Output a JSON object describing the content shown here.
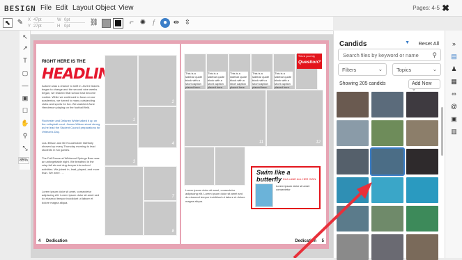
{
  "app": {
    "logo": "BESIGN",
    "menus": [
      "File",
      "Edit",
      "Layout",
      "Object",
      "View"
    ],
    "pages_label": "Pages: 4-5",
    "close": "✖"
  },
  "toolbar": {
    "x_label": "X",
    "x_val": "47pt",
    "w_label": "W",
    "w_val": "0pt",
    "y_label": "Y",
    "y_val": "27pt",
    "h_label": "H",
    "h_val": "0pt"
  },
  "zoom": "85%",
  "left_page": {
    "headline_small": "RIGHT HERE IS THE",
    "headline_big": "HEADLINE",
    "body1": "Autumn was a chance to shift in. As the leaves began to change and the second nine weeks began, we realized that school had become routine. While we continued to focus on our academics, we turned to many outstanding clubs and sports for fun. We watched Zane Henderson playing on the football field.",
    "body2": "Rochester and Delaney White talked it up on the volleyball court. James Wilson stood strong as he lead the Student Council preparations for Veteran's Day.",
    "body3": "Lulu Ellison and Bri Householder faithfully showed up every Thursday morning to lead students in fun games.",
    "body4": "The Fall Dance at Wildwood Springs Barn was an unforgettable night. We breathed in the crisp fall air and dug deeper into school activities. We joined in, lead, played, and more than. We were . . .",
    "captions": "Lorem ipsum dolor sit amet, consectetur adipiscing elit. Lorem ipsum dolor sit amet sed do eiusmod tempor incididunt ut labore et dolore magna aliqua.",
    "folio": "4",
    "dedication": "Dedication"
  },
  "right_page": {
    "quiz_small": "This is your big",
    "quiz_big": "Question?",
    "swim1": "Swim like a",
    "swim2": "butterfly",
    "swim3": "IN A LANE ALL HER OWN",
    "swim_caption": "Lorem ipsum dolor sit amet consectetur",
    "dedication": "Dedication",
    "folio": "5",
    "box_text": "This is a sidebar quote block with a short caption placed here."
  },
  "placeholders": [
    "1",
    "2",
    "3",
    "4",
    "7",
    "8",
    "11",
    "12"
  ],
  "panel": {
    "title": "Candids",
    "reset": "Reset All",
    "search_placeholder": "Search files by keyword or name",
    "filters": "Filters",
    "topics": "Topics",
    "count": "Showing 205 candids",
    "add_new": "Add New"
  },
  "rail_icons": [
    "expand-icon",
    "photo-icon",
    "person-icon",
    "layout-icon",
    "link-icon",
    "at-icon",
    "image-icon",
    "grid-icon"
  ],
  "colors": {
    "accent": "#e3141c",
    "spread": "#e7a4b4",
    "link": "#2a6ab3",
    "brand": "#3b7ec8"
  }
}
